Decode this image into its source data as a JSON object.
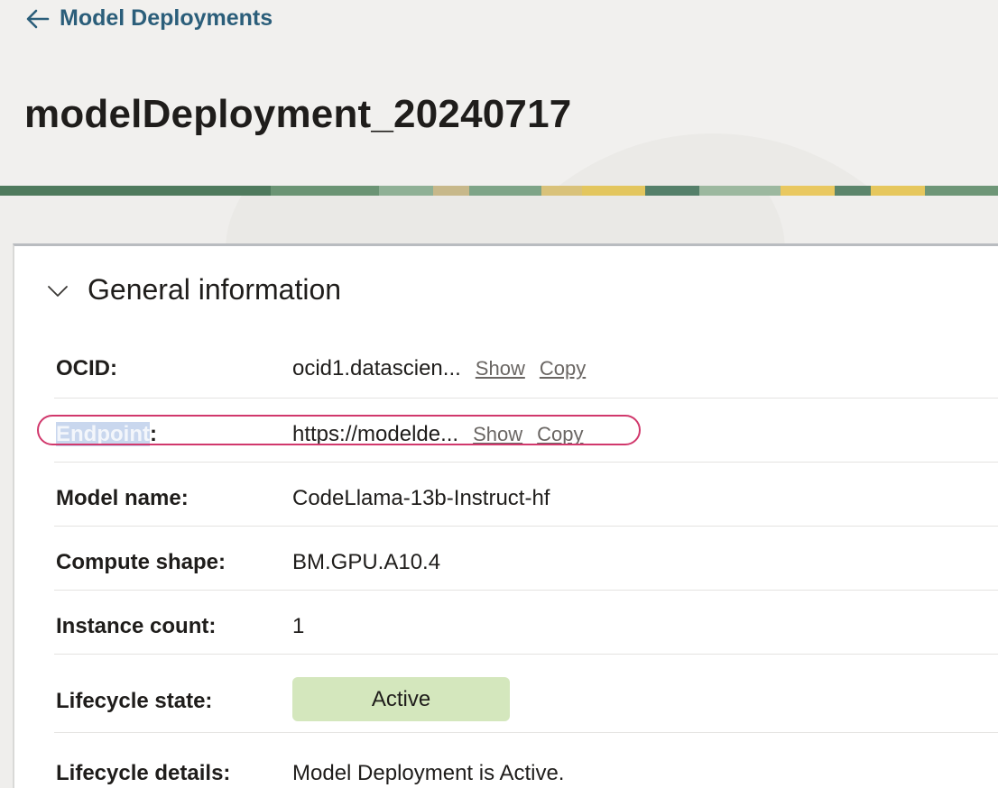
{
  "header": {
    "back_label": "Model Deployments",
    "title": "modelDeployment_20240717"
  },
  "section": {
    "title": "General information",
    "expanded": true
  },
  "rows": {
    "ocid": {
      "label": "OCID:",
      "value": "ocid1.datascien...",
      "show": "Show",
      "copy": "Copy"
    },
    "endpoint": {
      "label_highlighted": "Endpoint",
      "label_suffix": ":",
      "value": "https://modelde...",
      "show": "Show",
      "copy": "Copy"
    },
    "model_name": {
      "label": "Model name:",
      "value": "CodeLlama-13b-Instruct-hf"
    },
    "compute_shape": {
      "label": "Compute shape:",
      "value": "BM.GPU.A10.4"
    },
    "instance_count": {
      "label": "Instance count:",
      "value": "1"
    },
    "lifecycle_state": {
      "label": "Lifecycle state:",
      "value": "Active"
    },
    "lifecycle_details": {
      "label": "Lifecycle details:",
      "value": "Model Deployment is Active."
    }
  },
  "icons": {
    "back": "arrow-left-icon",
    "section_toggle": "chevron-down-icon"
  },
  "colors": {
    "link": "#2b5e7a",
    "status_active_bg": "#d4e7bd",
    "annotation": "#d1386c",
    "text_highlight": "#c9d7ee"
  }
}
